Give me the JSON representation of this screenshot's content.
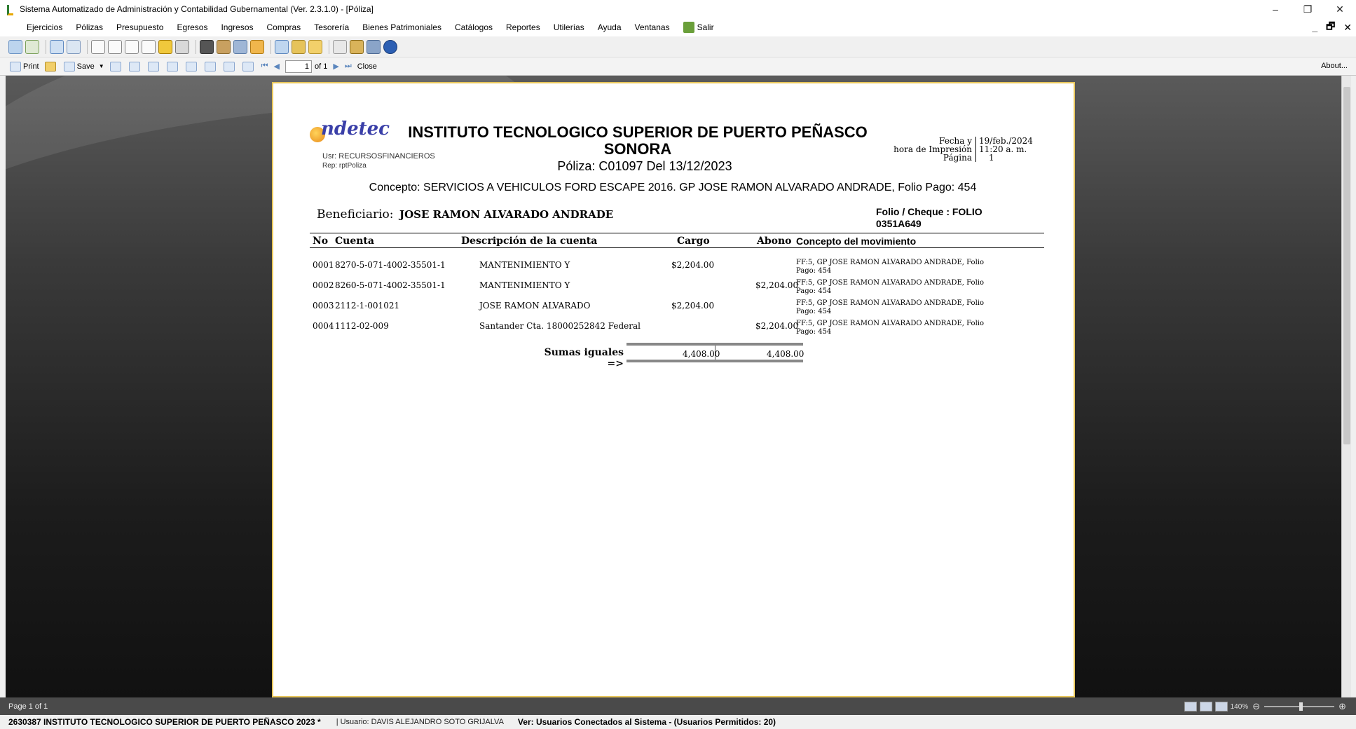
{
  "window": {
    "title": "Sistema Automatizado de Administración y Contabilidad Gubernamental  (Ver. 2.3.1.0) - [Póliza]",
    "controls": {
      "minimize": "–",
      "restore": "❐",
      "close": "✕"
    }
  },
  "menu": {
    "items": [
      "Ejercicios",
      "Pólizas",
      "Presupuesto",
      "Egresos",
      "Ingresos",
      "Compras",
      "Tesorería",
      "Bienes Patrimoniales",
      "Catálogos",
      "Reportes",
      "Utilerías",
      "Ayuda",
      "Ventanas",
      "Salir"
    ],
    "mdi_controls": {
      "minimize": "_",
      "restore": "🗗",
      "close": "✕"
    }
  },
  "report_toolbar": {
    "print": "Print",
    "save": "Save",
    "page_input": "1",
    "of_pages": "of 1",
    "close": "Close",
    "about": "About..."
  },
  "report": {
    "usr": "Usr: RECURSOSFINANCIEROS",
    "rep": "Rep: rptPoliza",
    "logo_text": "ndetec",
    "entity_line1": "INSTITUTO TECNOLOGICO SUPERIOR DE PUERTO PEÑASCO",
    "entity_line2": "SONORA",
    "poliza": "Póliza:  C01097  Del 13/12/2023",
    "fecha_labels": [
      "Fecha y",
      "hora de Impresión",
      "Página"
    ],
    "fecha_values": [
      "19/feb./2024",
      "11:20 a. m.",
      "1"
    ],
    "concepto": "Concepto: SERVICIOS A VEHICULOS FORD ESCAPE 2016. GP JOSE RAMON ALVARADO ANDRADE, Folio Pago: 454",
    "beneficiario_label": "Beneficiario:",
    "beneficiario": "JOSE RAMON ALVARADO ANDRADE",
    "folio_line1": "Folio / Cheque : FOLIO",
    "folio_line2": "0351A649",
    "table_headers": {
      "no": "No",
      "cuenta": "Cuenta",
      "descripcion": "Descripción de la cuenta",
      "cargo": "Cargo",
      "abono": "Abono",
      "concepto": "Concepto del movimiento"
    },
    "rows": [
      {
        "no": "0001",
        "cuenta": "8270-5-071-4002-35501-1",
        "descripcion": "MANTENIMIENTO Y",
        "cargo": "$2,204.00",
        "abono": "",
        "concepto": "FF:5, GP JOSE RAMON ALVARADO ANDRADE, Folio Pago: 454"
      },
      {
        "no": "0002",
        "cuenta": "8260-5-071-4002-35501-1",
        "descripcion": "MANTENIMIENTO Y",
        "cargo": "",
        "abono": "$2,204.00",
        "concepto": "FF:5, GP JOSE RAMON ALVARADO ANDRADE, Folio Pago: 454"
      },
      {
        "no": "0003",
        "cuenta": "2112-1-001021",
        "descripcion": "JOSE RAMON ALVARADO",
        "cargo": "$2,204.00",
        "abono": "",
        "concepto": "FF:5, GP JOSE RAMON ALVARADO ANDRADE, Folio Pago: 454"
      },
      {
        "no": "0004",
        "cuenta": "1112-02-009",
        "descripcion": "Santander Cta. 18000252842 Federal",
        "cargo": "",
        "abono": "$2,204.00",
        "concepto": "FF:5, GP JOSE RAMON ALVARADO ANDRADE, Folio Pago: 454"
      }
    ],
    "sumas_label": "Sumas iguales =>",
    "sumas_cargo": "4,408.00",
    "sumas_abono": "4,408.00"
  },
  "status": {
    "page": "Page 1 of 1",
    "zoom": "140%"
  },
  "bottom": {
    "entity": "2630387 INSTITUTO TECNOLOGICO SUPERIOR DE PUERTO PEÑASCO  2023   *",
    "user": "|  Usuario: DAVIS ALEJANDRO SOTO GRIJALVA",
    "connected": "Ver: Usuarios Conectados al Sistema - (Usuarios Permitidos: 20)"
  },
  "colors": {
    "page_border": "#e8c65a",
    "logo_blue": "#3a3fa8",
    "logo_orange": "#e88a1a",
    "viewer_bg": "#1c1c1c"
  }
}
